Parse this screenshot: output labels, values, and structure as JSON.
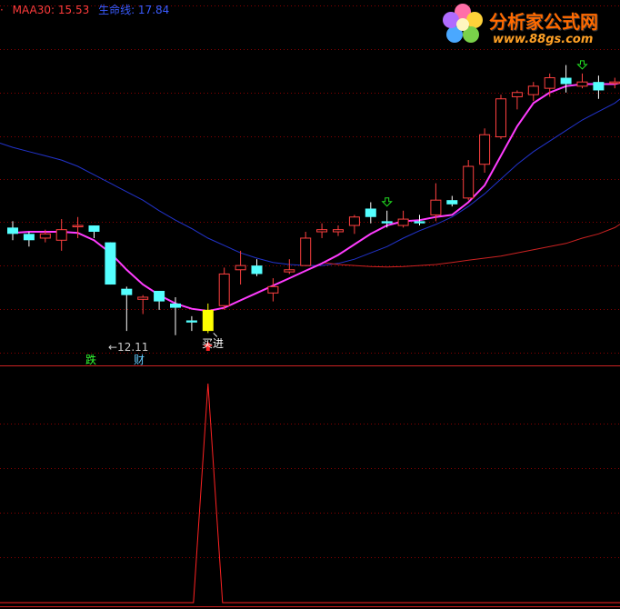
{
  "header": {
    "maa30_text": "MAA30: 15.53",
    "lifeline_text": "生命线: 17.84",
    "maa30_color": "#ff3b3b",
    "lifeline_color": "#3a5bff"
  },
  "logo": {
    "title": "分析家公式网",
    "url": "www.88gs.com"
  },
  "annotations": {
    "low_price": "←12.11",
    "fall_char": "跌",
    "wealth_char": "财",
    "buy_text": "买进"
  },
  "colors": {
    "up": "#ff4040",
    "down": "#54ffff",
    "buy_candle": "#ffff00",
    "ma_fast": "#ff3cff",
    "ma_mid": "#2233cc",
    "ma_slow": "#cc2222",
    "grid": "#8b0000",
    "signal": "#ff2222",
    "arrow_up": "#ff2222",
    "arrow_down": "#22dd22"
  },
  "chart_data": {
    "type": "candlestick",
    "candles": [
      {
        "o": 17.8,
        "c": 17.5,
        "h": 18.1,
        "l": 17.2
      },
      {
        "o": 17.5,
        "c": 17.2,
        "h": 17.6,
        "l": 16.9
      },
      {
        "o": 17.3,
        "c": 17.5,
        "h": 17.7,
        "l": 17.1
      },
      {
        "o": 17.2,
        "c": 17.7,
        "h": 18.2,
        "l": 16.7
      },
      {
        "o": 17.9,
        "c": 17.9,
        "h": 18.3,
        "l": 17.3
      },
      {
        "o": 17.9,
        "c": 17.6,
        "h": 17.9,
        "l": 17.3
      },
      {
        "o": 17.1,
        "c": 15.1,
        "h": 17.1,
        "l": 15.1
      },
      {
        "o": 14.9,
        "c": 14.6,
        "h": 15.0,
        "l": 12.9
      },
      {
        "o": 14.4,
        "c": 14.5,
        "h": 14.6,
        "l": 13.7
      },
      {
        "o": 14.8,
        "c": 14.3,
        "h": 14.8,
        "l": 13.9
      },
      {
        "o": 14.2,
        "c": 14.0,
        "h": 14.5,
        "l": 12.7
      },
      {
        "o": 13.4,
        "c": 13.3,
        "h": 13.6,
        "l": 12.9
      },
      {
        "o": 12.9,
        "c": 13.9,
        "h": 14.2,
        "l": 12.8,
        "buy": true
      },
      {
        "o": 14.1,
        "c": 15.6,
        "h": 15.9,
        "l": 13.9
      },
      {
        "o": 15.8,
        "c": 16.0,
        "h": 16.7,
        "l": 15.1
      },
      {
        "o": 16.0,
        "c": 15.6,
        "h": 16.3,
        "l": 15.5
      },
      {
        "o": 14.7,
        "c": 15.0,
        "h": 15.4,
        "l": 14.3
      },
      {
        "o": 15.7,
        "c": 15.8,
        "h": 16.3,
        "l": 15.6
      },
      {
        "o": 16.0,
        "c": 17.3,
        "h": 17.6,
        "l": 16.0
      },
      {
        "o": 17.6,
        "c": 17.7,
        "h": 18.0,
        "l": 17.3
      },
      {
        "o": 17.6,
        "c": 17.7,
        "h": 17.9,
        "l": 17.4
      },
      {
        "o": 17.9,
        "c": 18.3,
        "h": 18.4,
        "l": 17.5
      },
      {
        "o": 18.7,
        "c": 18.3,
        "h": 19.0,
        "l": 18.0
      },
      {
        "o": 18.1,
        "c": 18.0,
        "h": 18.6,
        "l": 17.8,
        "arrow_down": true
      },
      {
        "o": 17.9,
        "c": 18.2,
        "h": 18.6,
        "l": 17.8
      },
      {
        "o": 18.1,
        "c": 18.0,
        "h": 18.4,
        "l": 17.9
      },
      {
        "o": 18.4,
        "c": 19.1,
        "h": 19.9,
        "l": 18.1
      },
      {
        "o": 19.1,
        "c": 18.9,
        "h": 19.3,
        "l": 18.8
      },
      {
        "o": 19.2,
        "c": 20.7,
        "h": 21.0,
        "l": 19.1
      },
      {
        "o": 20.8,
        "c": 22.2,
        "h": 22.5,
        "l": 20.4
      },
      {
        "o": 22.1,
        "c": 23.9,
        "h": 24.1,
        "l": 22.0
      },
      {
        "o": 24.0,
        "c": 24.2,
        "h": 24.3,
        "l": 23.4
      },
      {
        "o": 24.1,
        "c": 24.5,
        "h": 24.7,
        "l": 23.8
      },
      {
        "o": 24.4,
        "c": 24.9,
        "h": 25.1,
        "l": 24.0
      },
      {
        "o": 24.9,
        "c": 24.6,
        "h": 25.5,
        "l": 24.2
      },
      {
        "o": 24.5,
        "c": 24.7,
        "h": 25.1,
        "l": 24.4,
        "arrow_down": true
      },
      {
        "o": 24.7,
        "c": 24.3,
        "h": 25.0,
        "l": 23.9
      },
      {
        "o": 24.7,
        "c": 24.7,
        "h": 24.9,
        "l": 24.4
      },
      {
        "o": 25.1,
        "c": 25.9,
        "h": 26.0,
        "l": 25.1
      }
    ],
    "ma_fast": [
      17.55,
      17.6,
      17.6,
      17.6,
      17.55,
      17.2,
      16.6,
      15.8,
      15.1,
      14.6,
      14.2,
      13.95,
      13.85,
      14.0,
      14.35,
      14.7,
      15.05,
      15.4,
      15.75,
      16.1,
      16.5,
      17.0,
      17.5,
      17.9,
      18.1,
      18.15,
      18.3,
      18.4,
      19.0,
      19.8,
      21.2,
      22.6,
      23.7,
      24.2,
      24.5,
      24.6,
      24.6,
      24.6,
      24.8
    ],
    "ma_mid": [
      21.6,
      21.4,
      21.2,
      21.0,
      20.7,
      20.3,
      19.9,
      19.5,
      19.1,
      18.6,
      18.15,
      17.75,
      17.3,
      16.95,
      16.6,
      16.35,
      16.15,
      16.05,
      16.0,
      16.0,
      16.1,
      16.3,
      16.6,
      16.9,
      17.3,
      17.65,
      17.95,
      18.3,
      18.8,
      19.4,
      20.1,
      20.8,
      21.4,
      21.9,
      22.4,
      22.9,
      23.3,
      23.7,
      24.3
    ],
    "ma_slow": [
      null,
      null,
      null,
      null,
      null,
      null,
      null,
      null,
      null,
      null,
      null,
      null,
      null,
      null,
      null,
      null,
      null,
      null,
      null,
      16.15,
      16.05,
      16.0,
      15.95,
      15.93,
      15.95,
      16.0,
      16.05,
      16.15,
      16.25,
      16.35,
      16.45,
      16.6,
      16.75,
      16.9,
      17.05,
      17.3,
      17.5,
      17.8,
      18.3
    ],
    "signal": [
      0,
      0,
      0,
      0,
      0,
      0,
      0,
      0,
      0,
      0,
      0,
      0,
      1,
      0,
      0,
      0,
      0,
      0,
      0,
      0,
      0,
      0,
      0,
      0,
      0,
      0,
      0,
      0,
      0,
      0,
      0,
      0,
      0,
      0,
      0,
      0,
      0,
      0,
      0
    ],
    "series_legend": [
      {
        "name": "MAA30",
        "value": 15.53
      },
      {
        "name": "生命线",
        "value": 17.84
      }
    ],
    "low_marker": {
      "index": 7,
      "value": 12.11
    },
    "buy_index": 12
  }
}
